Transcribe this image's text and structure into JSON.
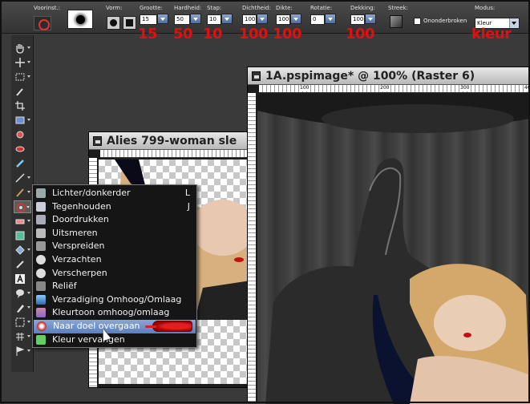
{
  "toolbar": {
    "voorinst_label": "Voorinst.:",
    "vorm_label": "Vorm:",
    "grootte_label": "Grootte:",
    "grootte_value": "15",
    "hardheid_label": "Hardheid:",
    "hardheid_value": "50",
    "stap_label": "Stap:",
    "stap_value": "10",
    "dichtheid_label": "Dichtheid:",
    "dichtheid_value": "100",
    "dikte_label": "Dikte:",
    "dikte_value": "100",
    "rotatie_label": "Rotatie:",
    "rotatie_value": "0",
    "dekking_label": "Dekking:",
    "dekking_value": "100",
    "streek_label": "Streek:",
    "ononderbroken_label": "Ononderbroken",
    "modus_label": "Modus:",
    "modus_value": "Kleur"
  },
  "annotations": {
    "grootte": "15",
    "hardheid": "50",
    "stap": "10",
    "dichtheid": "100",
    "dikte": "100",
    "dekking": "100",
    "modus": "kleur",
    "color": "#e01010"
  },
  "window_back": {
    "title": "Alies 799-woman sle"
  },
  "window_front": {
    "title": "1A.pspimage* @ 100% (Raster 6)",
    "ruler_labels": [
      "100",
      "200",
      "300",
      "400"
    ]
  },
  "menu": {
    "items": [
      {
        "label": "Lichter/donkerder",
        "shortcut": "L",
        "icon_color": "#9aa"
      },
      {
        "label": "Tegenhouden",
        "shortcut": "J",
        "icon_color": "#ccd"
      },
      {
        "label": "Doordrukken",
        "shortcut": "",
        "icon_color": "#aab"
      },
      {
        "label": "Uitsmeren",
        "shortcut": "",
        "icon_color": "#bbb"
      },
      {
        "label": "Verspreiden",
        "shortcut": "",
        "icon_color": "#999"
      },
      {
        "label": "Verzachten",
        "shortcut": "",
        "icon_color": "#ddd"
      },
      {
        "label": "Verscherpen",
        "shortcut": "",
        "icon_color": "#ddd"
      },
      {
        "label": "Reliëf",
        "shortcut": "",
        "icon_color": "#888"
      },
      {
        "label": "Verzadiging Omhoog/Omlaag",
        "shortcut": "",
        "icon_color": "#8cf"
      },
      {
        "label": "Kleurtoon omhoog/omlaag",
        "shortcut": "",
        "icon_color": "#c8a"
      },
      {
        "label": "Naar doel overgaan",
        "shortcut": "",
        "icon_color": "#c33"
      },
      {
        "label": "Kleur vervangen",
        "shortcut": "",
        "icon_color": "#6c6"
      }
    ],
    "highlight_color": "#5b7fbf"
  }
}
